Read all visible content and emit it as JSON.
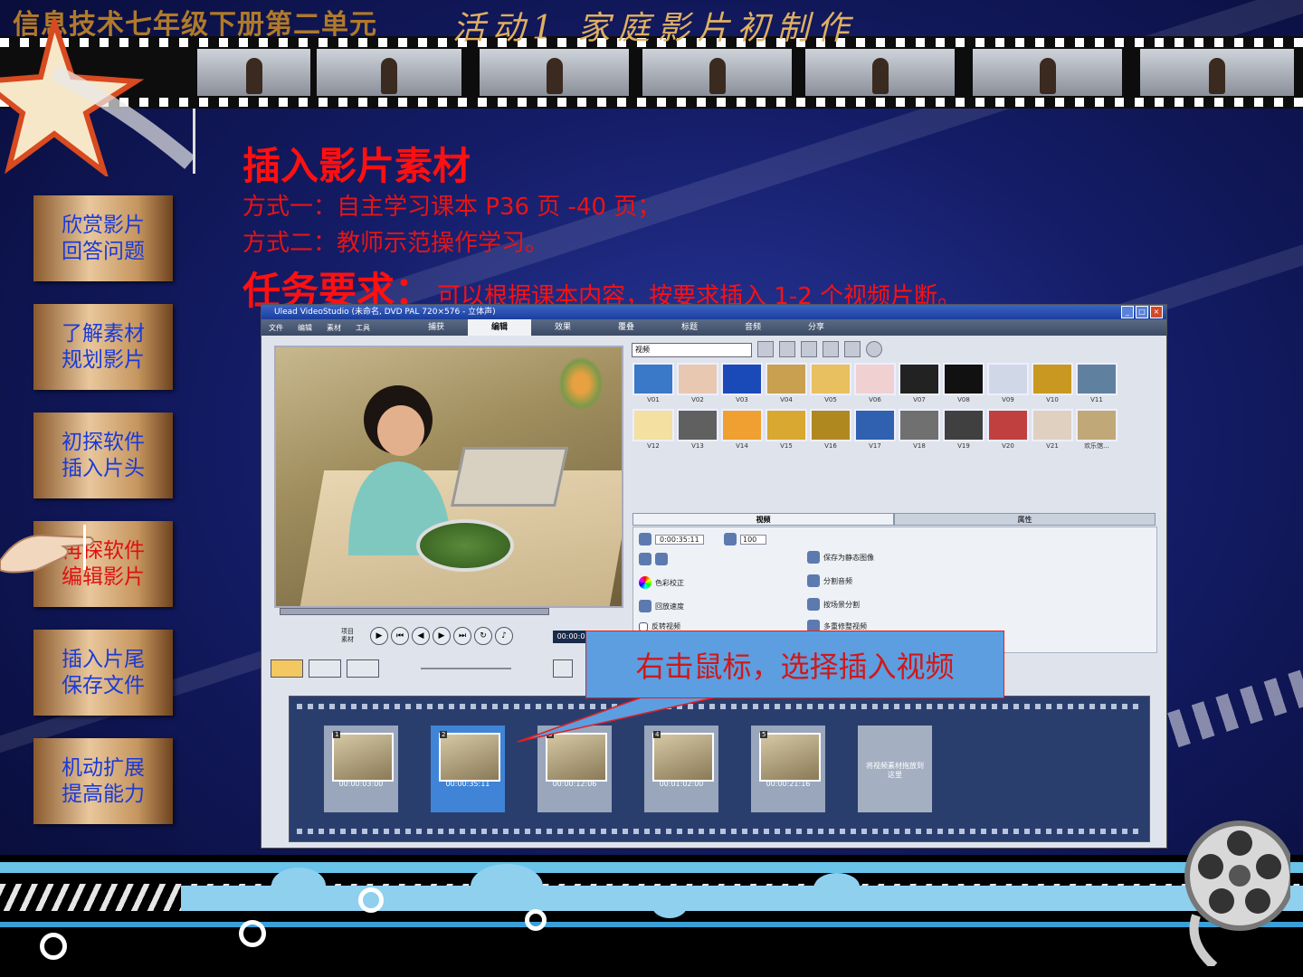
{
  "header": {
    "title": "信息技术七年级下册第二单元",
    "art_title": "活动1 家庭影片初制作"
  },
  "menu": [
    {
      "line1": "欣赏影片",
      "line2": "回答问题",
      "active": false
    },
    {
      "line1": "了解素材",
      "line2": "规划影片",
      "active": false
    },
    {
      "line1": "初探软件",
      "line2": "插入片头",
      "active": false
    },
    {
      "line1": "再探软件",
      "line2": "编辑影片",
      "active": true
    },
    {
      "line1": "插入片尾",
      "line2": "保存文件",
      "active": false
    },
    {
      "line1": "机动扩展",
      "line2": "提高能力",
      "active": false
    }
  ],
  "content": {
    "heading": "插入影片素材",
    "method1": "方式一：自主学习课本 P36 页 -40 页；",
    "method2": "方式二：教师示范操作学习。",
    "task_label": "任务要求：",
    "task_text": "可以根据课本内容，按要求插入 1-2 个视频片断。"
  },
  "app": {
    "window_title": "Ulead VideoStudio (未命名, DVD PAL 720×576 - 立体声)",
    "menus": [
      "文件",
      "编辑",
      "素材",
      "工具"
    ],
    "steps": [
      "捕获",
      "编辑",
      "效果",
      "覆叠",
      "标题",
      "音频",
      "分享"
    ],
    "active_step": "编辑",
    "project_label": "项目",
    "clip_label": "素材",
    "timecode": "00:00:0",
    "library_select": "视频",
    "library_items": [
      "V01",
      "V02",
      "V03",
      "V04",
      "V05",
      "V06",
      "V07",
      "V08",
      "V09",
      "V10",
      "V11",
      "V12",
      "V13",
      "V14",
      "V15",
      "V16",
      "V17",
      "V18",
      "V19",
      "V20",
      "V21",
      "欢乐馆..."
    ],
    "tabs": [
      "视频",
      "属性"
    ],
    "duration": "0:00:35:11",
    "volume": "100",
    "options_left": [
      "色彩校正",
      "回放速度",
      "反转视频"
    ],
    "options_right": [
      "保存为静态图像",
      "分割音频",
      "按场景分割",
      "多重修整视频"
    ],
    "clips": [
      {
        "num": "1",
        "time": "00:00:03:00"
      },
      {
        "num": "2",
        "time": "00:00:35:11"
      },
      {
        "num": "3",
        "time": "00:00:12:06"
      },
      {
        "num": "4",
        "time": "00:01:02:00"
      },
      {
        "num": "5",
        "time": "00:00:21:16"
      }
    ],
    "drop_hint": "将视频素材拖放到这里",
    "selected_clip": 2
  },
  "callout": {
    "text": "右击鼠标，选择插入视频"
  },
  "colors": {
    "background": "#141c66",
    "menu_text": "#1a3ad8",
    "active_menu_text": "#e01010",
    "heading_red": "#ff1010",
    "callout_bg": "#5c9ee0"
  }
}
